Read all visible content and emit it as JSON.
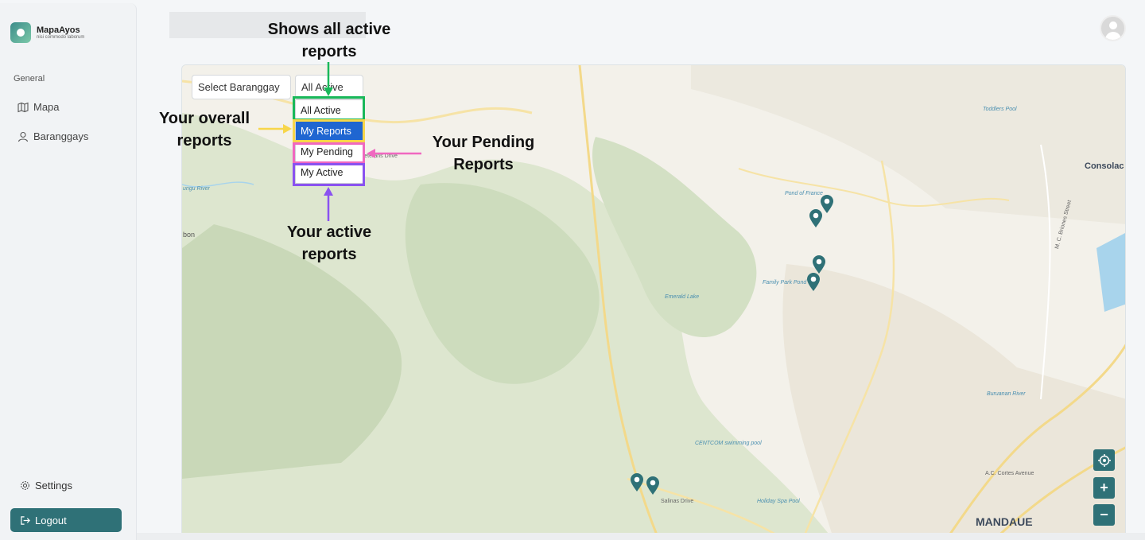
{
  "app": {
    "name": "MapaAyos",
    "tagline": "nisi commodo laborum"
  },
  "sidebar": {
    "section": "General",
    "items": [
      {
        "label": "Mapa",
        "icon": "map-icon"
      },
      {
        "label": "Baranggays",
        "icon": "user-icon"
      }
    ],
    "settings_label": "Settings",
    "logout_label": "Logout"
  },
  "filters": {
    "barangay_label": "Select Baranggay",
    "status_label": "All Active",
    "options": [
      "All Active",
      "My Reports",
      "My Pending",
      "My Active"
    ],
    "selected_option": "My Reports"
  },
  "annotations": {
    "all_active": "Shows all active reports",
    "overall": "Your overall reports",
    "pending": "Your Pending Reports",
    "active": "Your active reports"
  },
  "map": {
    "labels": [
      "Toddlers Pool",
      "Consolac",
      "Pond of France",
      "Family Park Pond",
      "Emerald Lake",
      "CENTCOM swimming pool",
      "Holiday Spa Pool",
      "MANDAUE",
      "Salinas Drive",
      "Veterans Drive",
      "M. C. Briones Street",
      "Buruanan River",
      "A.C. Cortes Avenue",
      "bon",
      "ungu River"
    ],
    "controls": {
      "locate": "locate-icon",
      "zoom_in": "+",
      "zoom_out": "−"
    }
  },
  "colors": {
    "accent": "#2f7177",
    "green": "#19b85a",
    "yellow": "#f7d64a",
    "pink": "#f068c0",
    "purple": "#8a52f0",
    "selected": "#1f66d1"
  }
}
